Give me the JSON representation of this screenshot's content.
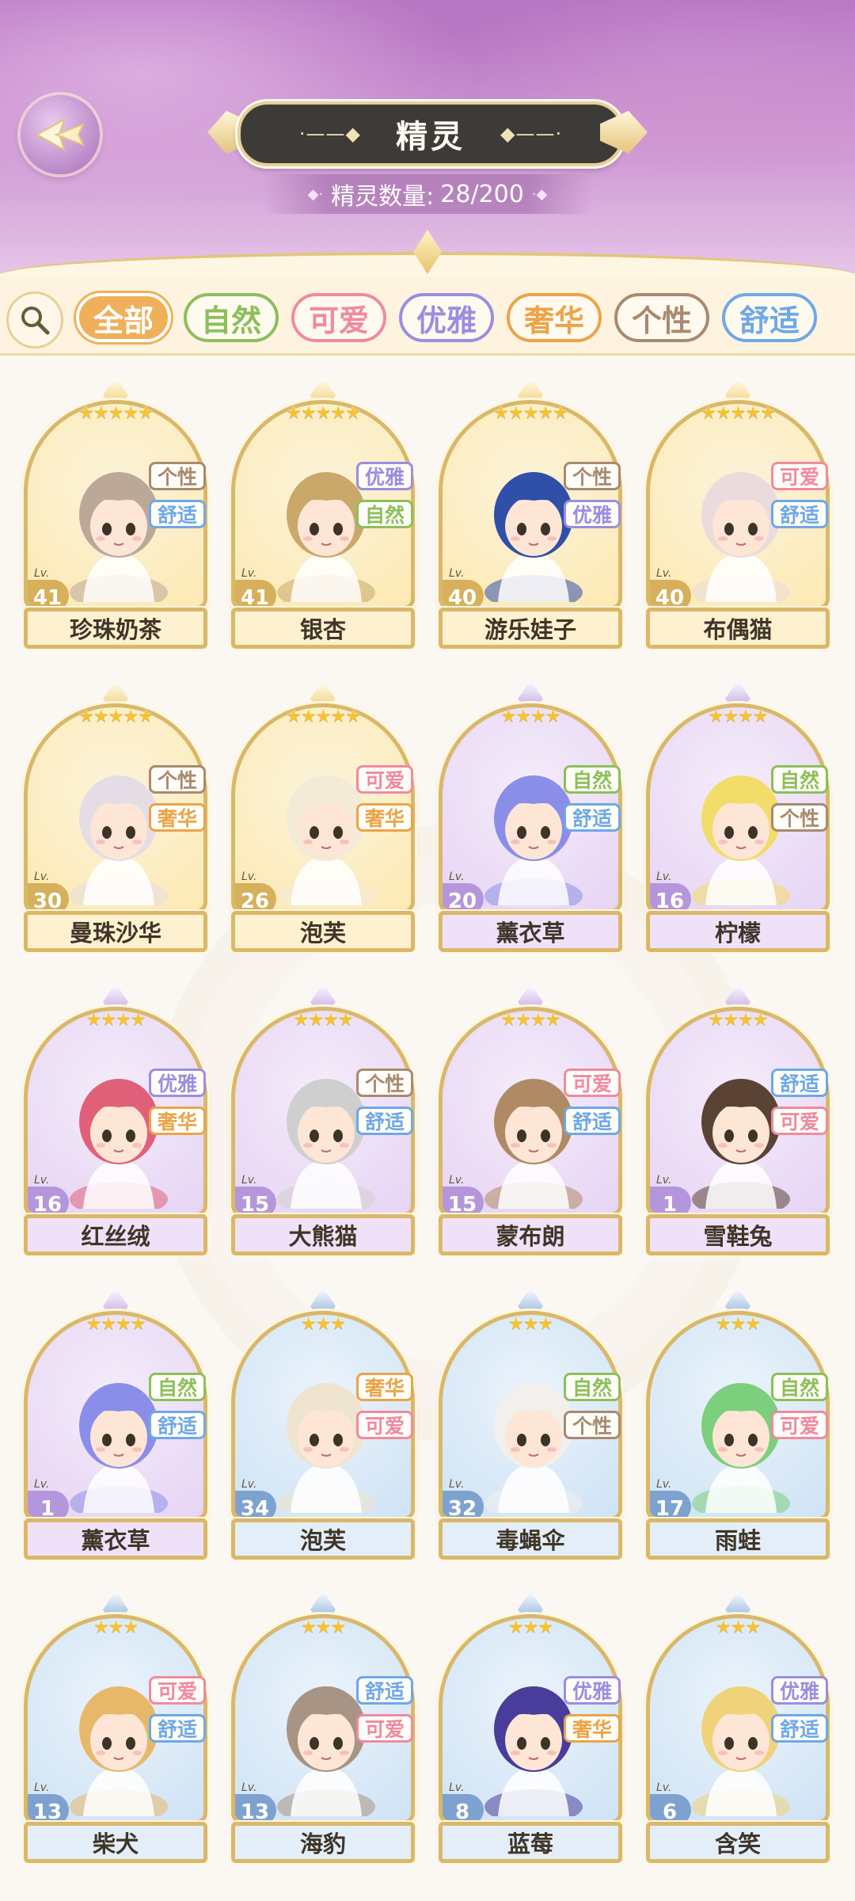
{
  "header": {
    "title": "精灵",
    "title_deco_left": "·——◆",
    "title_deco_right": "◆——·",
    "count_label": "精灵数量:",
    "count_value": "28/200"
  },
  "filters": [
    {
      "label": "全部",
      "active": true,
      "color": "#f0b05a"
    },
    {
      "label": "自然",
      "active": false,
      "color": "#8cbf5a"
    },
    {
      "label": "可爱",
      "active": false,
      "color": "#f08aa0"
    },
    {
      "label": "优雅",
      "active": false,
      "color": "#9a8ee0"
    },
    {
      "label": "奢华",
      "active": false,
      "color": "#eba448"
    },
    {
      "label": "个性",
      "active": false,
      "color": "#a88a70"
    },
    {
      "label": "舒适",
      "active": false,
      "color": "#6ea8e8"
    }
  ],
  "tag_colors": {
    "个性": "#a88a70",
    "舒适": "#6ea8e8",
    "优雅": "#9a8ee0",
    "自然": "#8cbf5a",
    "可爱": "#f08aa0",
    "奢华": "#eba448"
  },
  "rarity_styles": {
    "5": {
      "bg": "#fde9b3",
      "bg2": "#fbf3d9",
      "gem": "#f0c85a",
      "level": "#d6b05a"
    },
    "4": {
      "bg": "#e6d4f4",
      "bg2": "#f4ecfa",
      "gem": "#b89ae0",
      "level": "#b596dc"
    },
    "3": {
      "bg": "#cfe3f5",
      "bg2": "#eaf3fb",
      "gem": "#7fa8d8",
      "level": "#7ea2d0"
    }
  },
  "spirits": [
    {
      "name": "珍珠奶茶",
      "level": "41",
      "stars": 5,
      "tags": [
        "个性",
        "舒适"
      ],
      "hair": "#bba898"
    },
    {
      "name": "银杏",
      "level": "41",
      "stars": 5,
      "tags": [
        "优雅",
        "自然"
      ],
      "hair": "#c9a86a"
    },
    {
      "name": "游乐娃子",
      "level": "40",
      "stars": 5,
      "tags": [
        "个性",
        "优雅"
      ],
      "hair": "#2f4fa8"
    },
    {
      "name": "布偶猫",
      "level": "40",
      "stars": 5,
      "tags": [
        "可爱",
        "舒适"
      ],
      "hair": "#eadcdc"
    },
    {
      "name": "曼珠沙华",
      "level": "30",
      "stars": 5,
      "tags": [
        "个性",
        "奢华"
      ],
      "hair": "#e4dde6"
    },
    {
      "name": "泡芙",
      "level": "26",
      "stars": 5,
      "tags": [
        "可爱",
        "奢华"
      ],
      "hair": "#f4ead8"
    },
    {
      "name": "薰衣草",
      "level": "20",
      "stars": 4,
      "tags": [
        "自然",
        "舒适"
      ],
      "hair": "#8a8ee8"
    },
    {
      "name": "柠檬",
      "level": "16",
      "stars": 4,
      "tags": [
        "自然",
        "个性"
      ],
      "hair": "#f2dc6a"
    },
    {
      "name": "红丝绒",
      "level": "16",
      "stars": 4,
      "tags": [
        "优雅",
        "奢华"
      ],
      "hair": "#e0607a"
    },
    {
      "name": "大熊猫",
      "level": "15",
      "stars": 4,
      "tags": [
        "个性",
        "舒适"
      ],
      "hair": "#cfcfcf"
    },
    {
      "name": "蒙布朗",
      "level": "15",
      "stars": 4,
      "tags": [
        "可爱",
        "舒适"
      ],
      "hair": "#b08a64"
    },
    {
      "name": "雪鞋兔",
      "level": "1",
      "stars": 4,
      "tags": [
        "舒适",
        "可爱"
      ],
      "hair": "#5a4234"
    },
    {
      "name": "薰衣草",
      "level": "1",
      "stars": 4,
      "tags": [
        "自然",
        "舒适"
      ],
      "hair": "#8a8ee8"
    },
    {
      "name": "泡芙",
      "level": "34",
      "stars": 3,
      "tags": [
        "奢华",
        "可爱"
      ],
      "hair": "#efe4d0"
    },
    {
      "name": "毒蝇伞",
      "level": "32",
      "stars": 3,
      "tags": [
        "自然",
        "个性"
      ],
      "hair": "#f2efec"
    },
    {
      "name": "雨蛙",
      "level": "17",
      "stars": 3,
      "tags": [
        "自然",
        "可爱"
      ],
      "hair": "#7ccf7c"
    },
    {
      "name": "柴犬",
      "level": "13",
      "stars": 3,
      "tags": [
        "可爱",
        "舒适"
      ],
      "hair": "#e8b86a"
    },
    {
      "name": "海豹",
      "level": "13",
      "stars": 3,
      "tags": [
        "舒适",
        "可爱"
      ],
      "hair": "#a89484"
    },
    {
      "name": "蓝莓",
      "level": "8",
      "stars": 3,
      "tags": [
        "优雅",
        "奢华"
      ],
      "hair": "#4a3c9a"
    },
    {
      "name": "含笑",
      "level": "6",
      "stars": 3,
      "tags": [
        "优雅",
        "舒适"
      ],
      "hair": "#f0d27a"
    }
  ],
  "level_prefix": "Lv."
}
